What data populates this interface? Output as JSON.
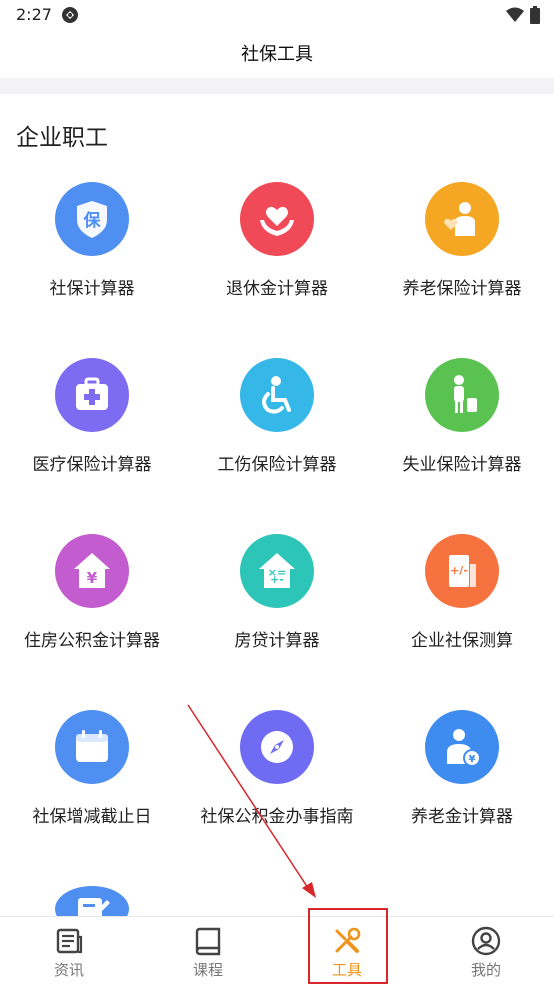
{
  "status": {
    "time": "2:27"
  },
  "header": {
    "title": "社保工具"
  },
  "section": {
    "title": "企业职工"
  },
  "tools": [
    {
      "label": "社保计算器",
      "icon": "shield-icon",
      "color": "#4f8ff2"
    },
    {
      "label": "退休金计算器",
      "icon": "heart-hands-icon",
      "color": "#f04a58"
    },
    {
      "label": "养老保险计算器",
      "icon": "elder-care-icon",
      "color": "#f5a623"
    },
    {
      "label": "医疗保险计算器",
      "icon": "medical-kit-icon",
      "color": "#7d6cf1"
    },
    {
      "label": "工伤保险计算器",
      "icon": "wheelchair-icon",
      "color": "#35b8e8"
    },
    {
      "label": "失业保险计算器",
      "icon": "person-luggage-icon",
      "color": "#5ac251"
    },
    {
      "label": "住房公积金计算器",
      "icon": "house-yuan-icon",
      "color": "#c35cce"
    },
    {
      "label": "房贷计算器",
      "icon": "house-math-icon",
      "color": "#2ec5b9"
    },
    {
      "label": "企业社保测算",
      "icon": "building-calc-icon",
      "color": "#f6733f"
    },
    {
      "label": "社保增减截止日",
      "icon": "calendar-icon",
      "color": "#4f8ff2"
    },
    {
      "label": "社保公积金办事指南",
      "icon": "compass-icon",
      "color": "#6f6cf3"
    },
    {
      "label": "养老金计算器",
      "icon": "elder-yuan-icon",
      "color": "#3e8cf0"
    },
    {
      "label": "",
      "icon": "form-edit-icon",
      "color": "#4f8ff2"
    }
  ],
  "nav": {
    "items": [
      {
        "label": "资讯",
        "icon": "news-icon"
      },
      {
        "label": "课程",
        "icon": "book-icon"
      },
      {
        "label": "工具",
        "icon": "tools-icon"
      },
      {
        "label": "我的",
        "icon": "profile-icon"
      }
    ],
    "active_color": "#f0931c",
    "inactive_color": "#777777"
  }
}
